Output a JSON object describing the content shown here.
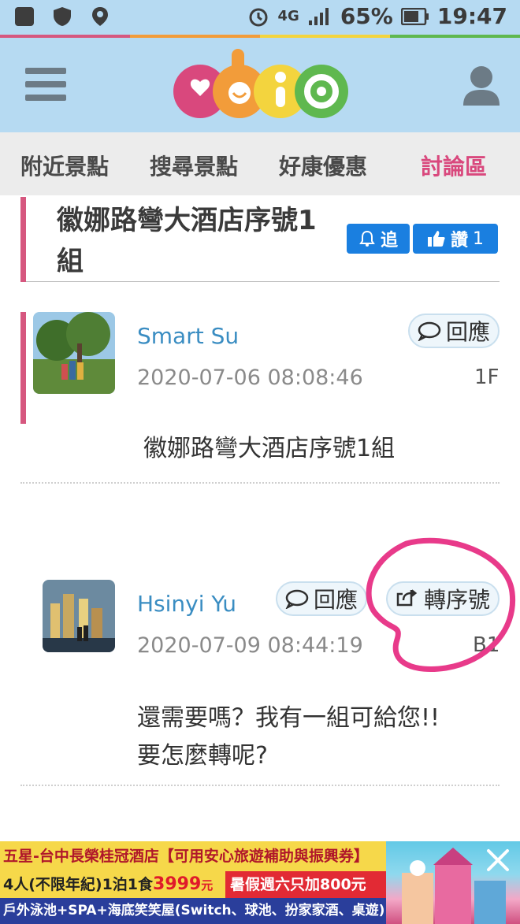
{
  "status_bar": {
    "network": "4G",
    "battery": "65%",
    "time": "19:47"
  },
  "header": {
    "logo_text": "abic"
  },
  "nav": {
    "items": [
      "附近景點",
      "搜尋景點",
      "好康優惠",
      "討論區"
    ],
    "active_index": 3
  },
  "topic": {
    "title_line1": "徽娜路彎大酒店序號1",
    "title_line2": "組",
    "follow_label": "追",
    "like_label": "讚",
    "like_count": "1"
  },
  "posts": [
    {
      "author": "Smart Su",
      "timestamp": "2020-07-06 08:08:46",
      "floor": "1F",
      "reply_label": "回應",
      "content": "徽娜路彎大酒店序號1組"
    },
    {
      "author": "Hsinyi Yu",
      "timestamp": "2020-07-09 08:44:19",
      "floor": "B1",
      "reply_label": "回應",
      "forward_label": "轉序號",
      "content_line1": "還需要嗎？我有一組可給您!!",
      "content_line2": "要怎麼轉呢?"
    }
  ],
  "ad": {
    "line1": "五星-台中長榮桂冠酒店【可用安心旅遊補助與振興券】",
    "line2_prefix": "4人(不限年紀)1泊1食",
    "line2_price": "3999",
    "line2_unit": "元",
    "line2_right": "暑假週六只加800元",
    "line3": "戶外泳池+SPA+海底笑笑屋(Switch、球池、扮家家酒、桌遊)..."
  },
  "colors": {
    "header_bg": "#b6daf2",
    "accent_pink": "#d9487d",
    "button_blue": "#1a7fe0",
    "author_blue": "#3a8dc2"
  }
}
